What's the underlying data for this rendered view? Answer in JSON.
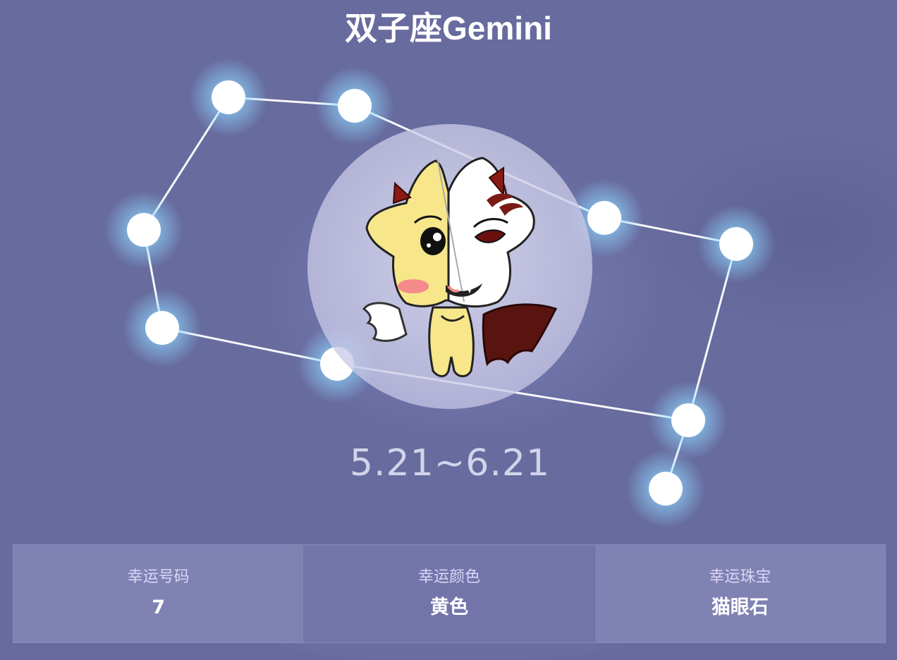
{
  "header": {
    "title": "双子座Gemini"
  },
  "sign": {
    "date_range": "5.21~6.21",
    "mascot_icon": "gemini-angel-devil-mascot"
  },
  "lucky": [
    {
      "label": "幸运号码",
      "value": "7"
    },
    {
      "label": "幸运颜色",
      "value": "黄色"
    },
    {
      "label": "幸运珠宝",
      "value": "猫眼石"
    }
  ],
  "colors": {
    "background": "#676b9e",
    "panel_light": "#8082b3",
    "panel_dark": "#7375aa",
    "star_glow": "#8fd8ff",
    "mascot_yellow": "#f7e68a",
    "devil_horn": "#8b1a14"
  }
}
